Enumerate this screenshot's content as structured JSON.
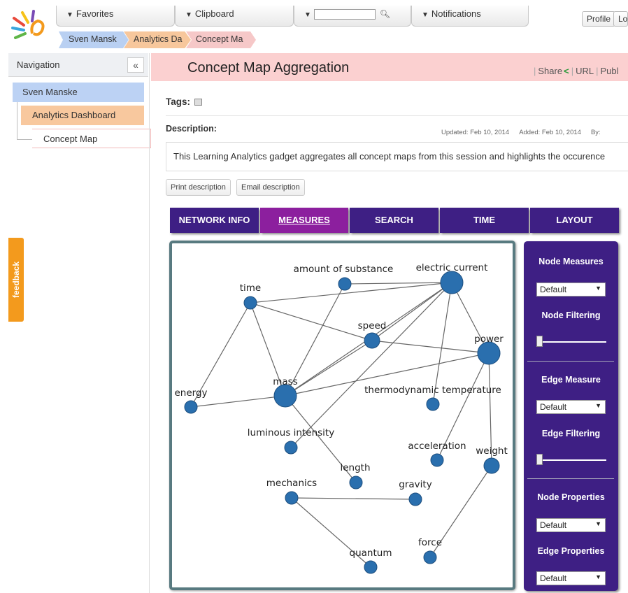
{
  "menubar": {
    "favorites": "Favorites",
    "clipboard": "Clipboard",
    "search_value": "",
    "notifications": "Notifications",
    "profile": "Profile",
    "logout": "Lo"
  },
  "breadcrumb": [
    "Sven Mansk",
    "Analytics Da",
    "Concept Ma"
  ],
  "sidebar": {
    "heading": "Navigation",
    "collapse": "«",
    "tree": [
      "Sven Manske",
      "Analytics Dashboard",
      "Concept Map"
    ],
    "feedback": "feedback"
  },
  "page": {
    "title": "Concept Map Aggregation",
    "share": "Share",
    "url": "URL",
    "publish": "Publ",
    "tags_label": "Tags:",
    "description_label": "Description:",
    "updated": "Updated:  Feb 10, 2014",
    "added": "Added:  Feb 10, 2014",
    "by": "By:",
    "description": "This Learning Analytics gadget aggregates all concept maps from this session and highlights the occurence",
    "print_button": "Print description",
    "email_button": "Email description"
  },
  "tabs": [
    "NETWORK INFO",
    "MEASURES",
    "SEARCH",
    "TIME",
    "LAYOUT"
  ],
  "active_tab": "MEASURES",
  "panel": {
    "node_measures": "Node Measures",
    "node_measures_value": "Default",
    "node_filtering": "Node Filtering",
    "edge_measure": "Edge Measure",
    "edge_measure_value": "Default",
    "edge_filtering": "Edge Filtering",
    "node_properties": "Node Properties",
    "node_properties_value": "Default",
    "edge_properties": "Edge Properties",
    "edge_properties_value": "Default"
  },
  "graph": {
    "node_color": "#2a6fae",
    "nodes": [
      {
        "id": "amount",
        "label": "amount of substance",
        "size": "small"
      },
      {
        "id": "electric",
        "label": "electric current",
        "size": "large"
      },
      {
        "id": "time",
        "label": "time",
        "size": "small"
      },
      {
        "id": "speed",
        "label": "speed",
        "size": "medium"
      },
      {
        "id": "power",
        "label": "power",
        "size": "large"
      },
      {
        "id": "mass",
        "label": "mass",
        "size": "large"
      },
      {
        "id": "energy",
        "label": "energy",
        "size": "small"
      },
      {
        "id": "thermo",
        "label": "thermodynamic temperature",
        "size": "small"
      },
      {
        "id": "luminous",
        "label": "luminous intensity",
        "size": "small"
      },
      {
        "id": "acceleration",
        "label": "acceleration",
        "size": "small"
      },
      {
        "id": "weight",
        "label": "weight",
        "size": "medium"
      },
      {
        "id": "length",
        "label": "length",
        "size": "small"
      },
      {
        "id": "mechanics",
        "label": "mechanics",
        "size": "small"
      },
      {
        "id": "gravity",
        "label": "gravity",
        "size": "small"
      },
      {
        "id": "force",
        "label": "force",
        "size": "small"
      },
      {
        "id": "quantum",
        "label": "quantum",
        "size": "small"
      }
    ],
    "edges": [
      [
        "amount",
        "electric"
      ],
      [
        "time",
        "electric"
      ],
      [
        "time",
        "speed"
      ],
      [
        "time",
        "energy"
      ],
      [
        "time",
        "mass"
      ],
      [
        "amount",
        "mass"
      ],
      [
        "electric",
        "speed"
      ],
      [
        "electric",
        "mass"
      ],
      [
        "electric",
        "power"
      ],
      [
        "electric",
        "thermo"
      ],
      [
        "electric",
        "luminous"
      ],
      [
        "speed",
        "power"
      ],
      [
        "speed",
        "mass"
      ],
      [
        "power",
        "mass"
      ],
      [
        "power",
        "acceleration"
      ],
      [
        "power",
        "weight"
      ],
      [
        "mass",
        "energy"
      ],
      [
        "mass",
        "length"
      ],
      [
        "weight",
        "force"
      ],
      [
        "mechanics",
        "gravity"
      ],
      [
        "mechanics",
        "quantum"
      ]
    ]
  }
}
